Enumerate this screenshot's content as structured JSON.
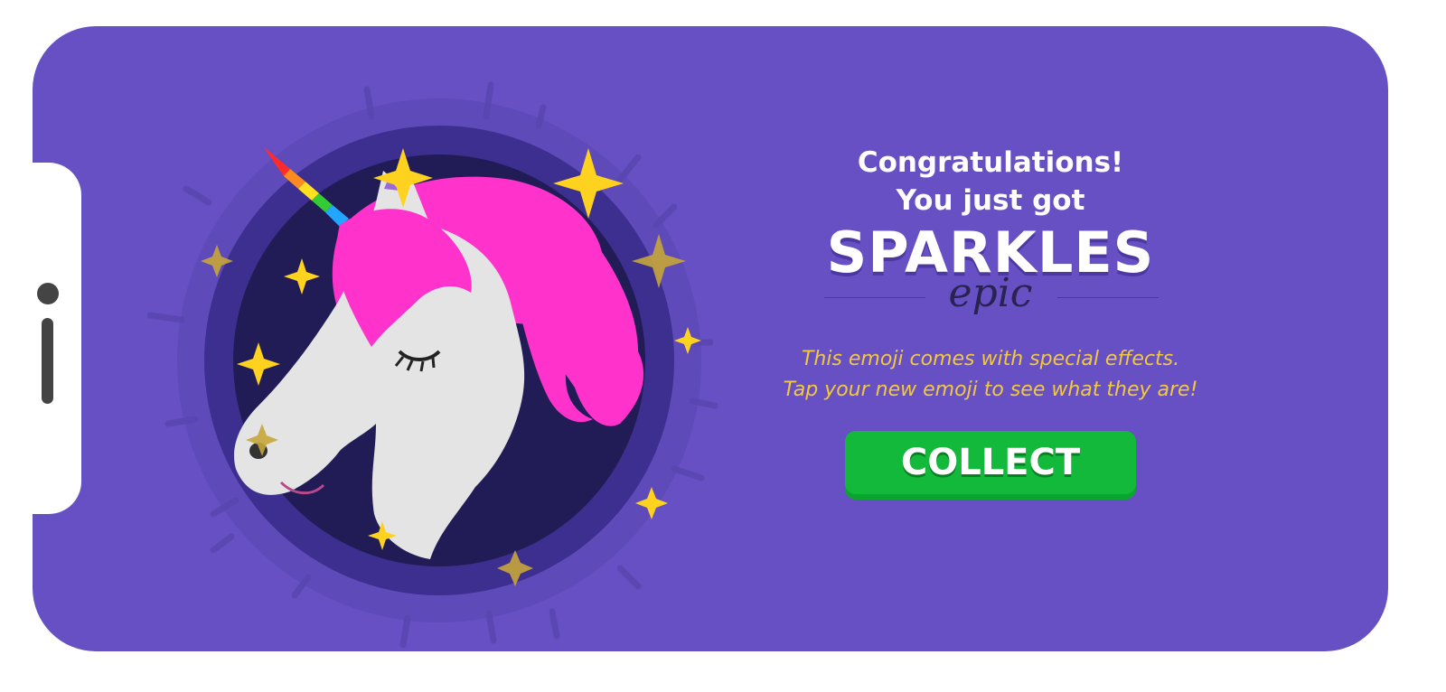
{
  "reward": {
    "congrats_line1": "Congratulations!",
    "congrats_line2": "You just got",
    "item_name": "SPARKLES",
    "rarity": "epic",
    "effects_line1": "This emoji comes with special effects.",
    "effects_line2": "Tap your new emoji to see what they are!",
    "collect_label": "COLLECT"
  },
  "illustration": {
    "subject": "unicorn-head",
    "decorations": "sparkle-stars"
  },
  "colors": {
    "background": "#6650c4",
    "circle_outer": "#3d2f8f",
    "circle_inner": "#221c56",
    "mane": "#ff33cc",
    "horse": "#e4e4e4",
    "sparkle": "#ffd21f",
    "effects_text": "#f3c93b",
    "button": "#13b93a",
    "rarity_text": "#2a2250"
  }
}
